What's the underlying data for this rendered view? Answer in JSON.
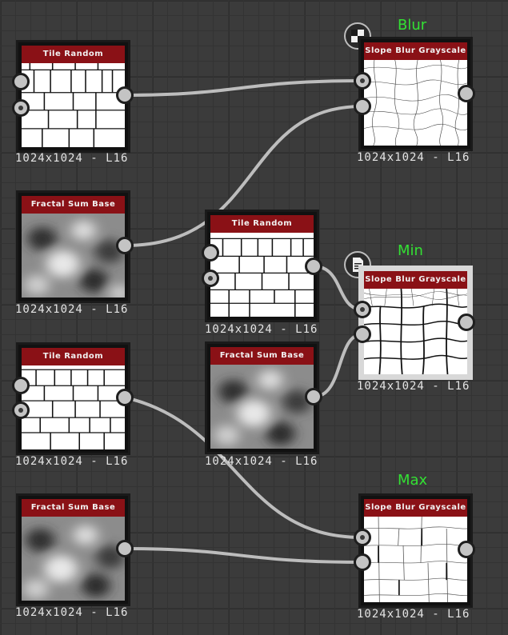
{
  "comments": {
    "blur": "Blur",
    "min": "Min",
    "max": "Max"
  },
  "nodes": {
    "tile_random_1": {
      "title": "Tile Random",
      "res": "1024x1024 - L16"
    },
    "fractal_sum_1": {
      "title": "Fractal Sum Base",
      "res": "1024x1024 - L16"
    },
    "tile_random_2": {
      "title": "Tile Random",
      "res": "1024x1024 - L16"
    },
    "tile_random_3": {
      "title": "Tile Random",
      "res": "1024x1024 - L16"
    },
    "fractal_sum_2": {
      "title": "Fractal Sum Base",
      "res": "1024x1024 - L16"
    },
    "fractal_sum_3": {
      "title": "Fractal Sum Base",
      "res": "1024x1024 - L16"
    },
    "slope_blur_1": {
      "title": "Slope Blur Grayscale",
      "res": "1024x1024 - L16"
    },
    "slope_blur_2": {
      "title": "Slope Blur Grayscale",
      "res": "1024x1024 - L16"
    },
    "slope_blur_3": {
      "title": "Slope Blur Grayscale",
      "res": "1024x1024 - L16"
    }
  },
  "icons": {
    "blur_badge": "checker-pattern-icon",
    "min_badge": "document-list-icon"
  },
  "colors": {
    "canvas": "#3b3b3b",
    "node_title": "#8a1116",
    "comment_text": "#33e033",
    "wire": "#bdbdbd"
  }
}
